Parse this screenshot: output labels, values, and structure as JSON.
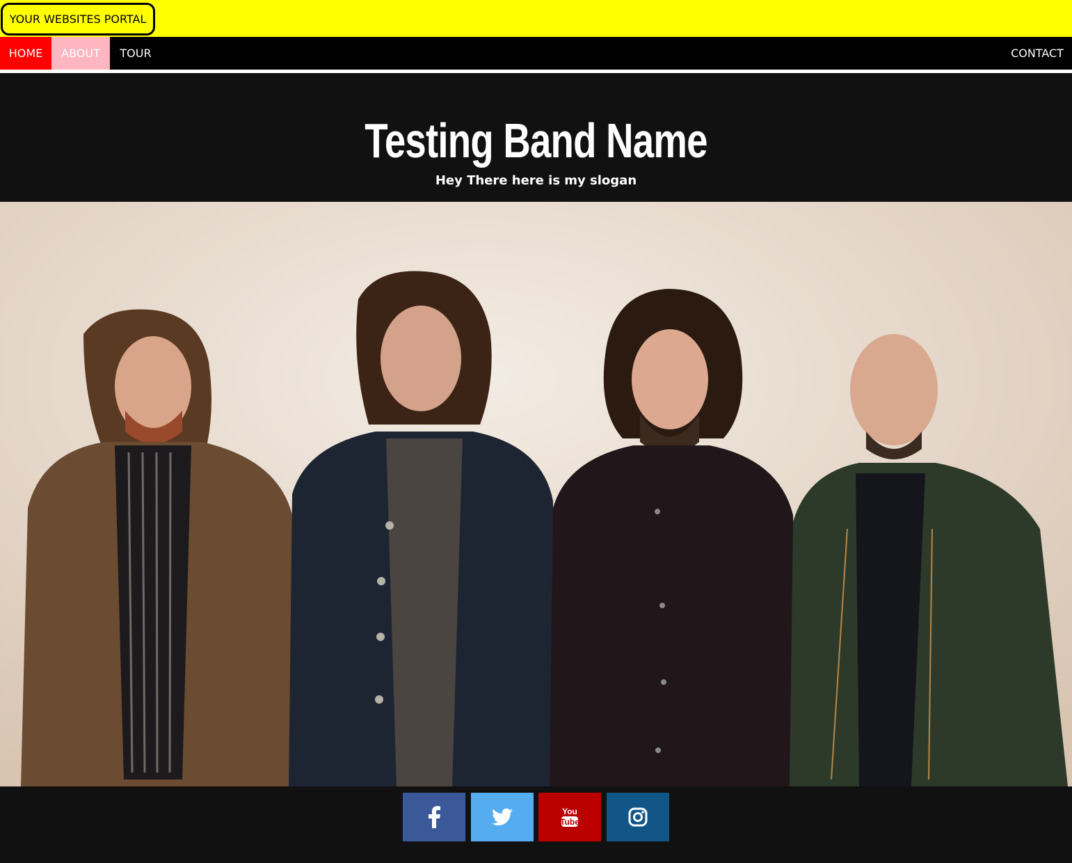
{
  "portal": {
    "label": "YOUR WEBSITES PORTAL"
  },
  "nav": {
    "home": "HOME",
    "about": "ABOUT",
    "tour": "TOUR",
    "contact": "CONTACT"
  },
  "header": {
    "band_name": "Testing Band Name",
    "slogan": "Hey There here is my slogan"
  },
  "hero": {
    "icon": "band-photo"
  },
  "social": [
    {
      "icon": "facebook-icon",
      "color": "#3b5998"
    },
    {
      "icon": "twitter-icon",
      "color": "#55acee"
    },
    {
      "icon": "youtube-icon",
      "color": "#bb0000",
      "text_top": "You",
      "text_bottom": "Tube"
    },
    {
      "icon": "instagram-icon",
      "color": "#125688"
    }
  ],
  "colors": {
    "portal_bar": "#ffff00",
    "nav_home": "#ff0000",
    "nav_about": "#ffb6c1",
    "background": "#111111"
  }
}
